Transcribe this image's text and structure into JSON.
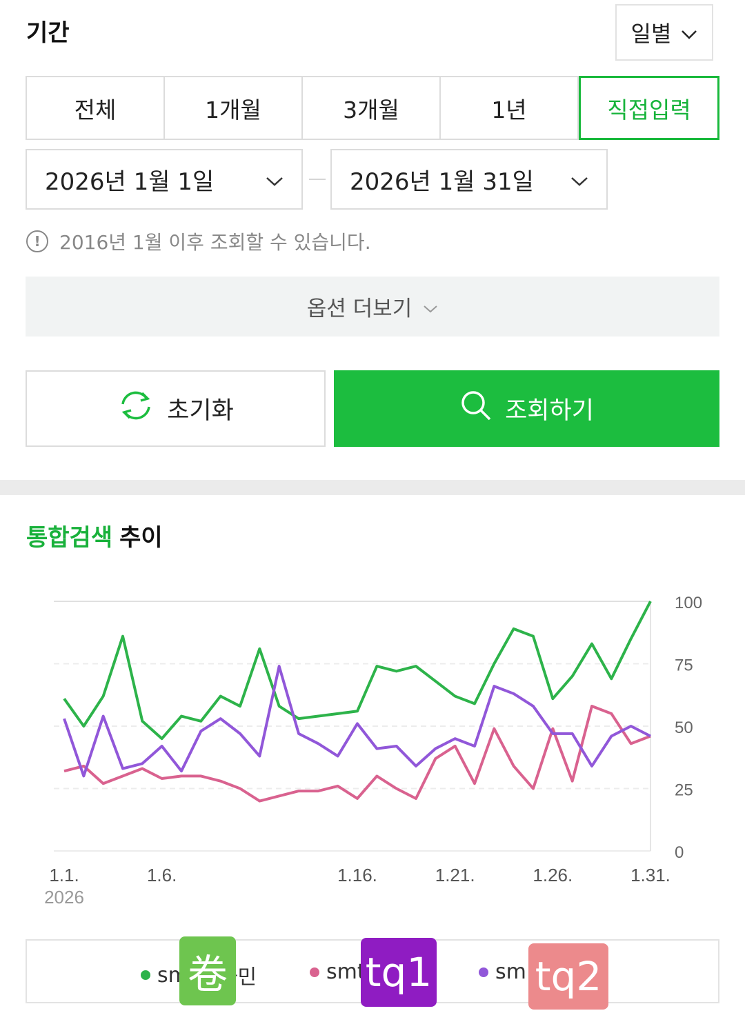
{
  "filter": {
    "title": "기간",
    "unit_select": "일별",
    "tabs": [
      {
        "label": "전체"
      },
      {
        "label": "1개월"
      },
      {
        "label": "3개월"
      },
      {
        "label": "1년"
      },
      {
        "label": "직접입력",
        "active": true
      }
    ],
    "start_date": "2026년 1월 1일",
    "end_date": "2026년 1월 31일",
    "notice": "2016년 1월 이후 조회할 수 있습니다.",
    "more_options": "옵션 더보기",
    "reset_label": "초기화",
    "search_label": "조회하기"
  },
  "section": {
    "title_green": "통합검색",
    "title_dark": "추이"
  },
  "legend": {
    "item1": "sm",
    "item1_suffix": "하민",
    "item2": "smt",
    "item3": "sm"
  },
  "stickers": {
    "s1": "卷",
    "s2": "tq1",
    "s3": "tq2"
  },
  "colors": {
    "accent_green": "#1cbd3f",
    "series_green": "#2db34a",
    "series_pink": "#d9628f",
    "series_purple": "#9157d9"
  },
  "chart_data": {
    "type": "line",
    "x": [
      1,
      2,
      3,
      4,
      5,
      6,
      7,
      8,
      9,
      10,
      11,
      12,
      13,
      14,
      15,
      16,
      17,
      18,
      19,
      20,
      21,
      22,
      23,
      24,
      25,
      26,
      27,
      28,
      29,
      30,
      31
    ],
    "x_tick_labels": [
      "1.1.",
      "1.6.",
      "1.16.",
      "1.21.",
      "1.26.",
      "1.31."
    ],
    "x_tick_positions": [
      1,
      6,
      16,
      21,
      26,
      31
    ],
    "x_sublabel": "2026",
    "y_ticks": [
      0,
      25,
      50,
      75,
      100
    ],
    "ylim": [
      0,
      100
    ],
    "grid": true,
    "series": [
      {
        "color": "#2db34a",
        "values": [
          61,
          50,
          62,
          86,
          52,
          45,
          54,
          52,
          62,
          58,
          81,
          58,
          53,
          54,
          55,
          56,
          74,
          72,
          74,
          68,
          62,
          59,
          75,
          89,
          86,
          61,
          70,
          83,
          69,
          85,
          100
        ]
      },
      {
        "color": "#d9628f",
        "values": [
          32,
          34,
          27,
          30,
          33,
          29,
          30,
          30,
          28,
          25,
          20,
          22,
          24,
          24,
          26,
          21,
          30,
          25,
          21,
          37,
          42,
          27,
          49,
          34,
          25,
          49,
          28,
          58,
          55,
          43,
          46
        ]
      },
      {
        "color": "#9157d9",
        "values": [
          53,
          30,
          54,
          33,
          35,
          42,
          32,
          48,
          53,
          47,
          38,
          74,
          47,
          43,
          38,
          51,
          41,
          42,
          34,
          41,
          45,
          42,
          66,
          63,
          58,
          47,
          47,
          34,
          46,
          50,
          46
        ]
      }
    ]
  }
}
